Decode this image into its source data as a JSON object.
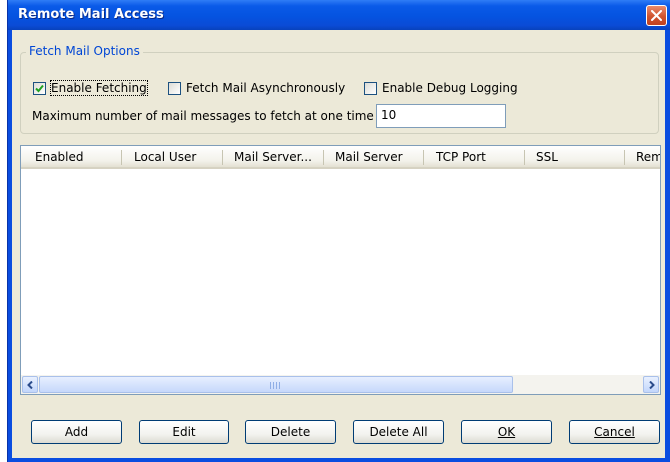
{
  "window": {
    "title": "Remote Mail Access"
  },
  "fetch_options": {
    "group_label": "Fetch Mail Options",
    "enable_fetching": {
      "label": "Enable Fetching",
      "checked": true
    },
    "fetch_async": {
      "label": "Fetch Mail Asynchronously",
      "checked": false
    },
    "debug_logging": {
      "label": "Enable Debug Logging",
      "checked": false
    },
    "max_messages_label": "Maximum number of mail messages to fetch at one time",
    "max_messages_value": "10"
  },
  "table": {
    "columns": [
      "Enabled",
      "Local User",
      "Mail Server...",
      "Mail Server",
      "TCP Port",
      "SSL",
      "Rem"
    ],
    "rows": []
  },
  "scrollbar": {
    "left_arrow": "left-arrow-icon",
    "right_arrow": "right-arrow-icon"
  },
  "buttons": {
    "add": "Add",
    "edit": "Edit",
    "delete": "Delete",
    "delete_all": "Delete All",
    "ok": "OK",
    "cancel": "Cancel"
  },
  "colors": {
    "title_bar": "#0553e0",
    "client_bg": "#ece9d8",
    "group_label": "#0046d5",
    "close_button": "#d0542f"
  }
}
